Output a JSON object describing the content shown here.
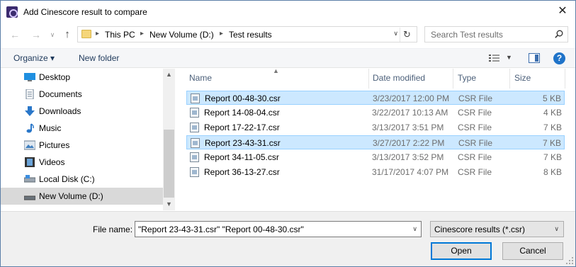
{
  "window": {
    "title": "Add Cinescore result to compare",
    "close_glyph": "✕"
  },
  "address": {
    "crumbs": [
      "This PC",
      "New Volume (D:)",
      "Test results"
    ],
    "search_placeholder": "Search Test results"
  },
  "toolbar": {
    "organize_label": "Organize ▾",
    "new_folder_label": "New folder",
    "help_glyph": "?"
  },
  "nav": {
    "items": [
      {
        "label": "Desktop",
        "icon": "desktop-icon"
      },
      {
        "label": "Documents",
        "icon": "documents-icon"
      },
      {
        "label": "Downloads",
        "icon": "downloads-icon"
      },
      {
        "label": "Music",
        "icon": "music-icon"
      },
      {
        "label": "Pictures",
        "icon": "pictures-icon"
      },
      {
        "label": "Videos",
        "icon": "videos-icon"
      },
      {
        "label": "Local Disk (C:)",
        "icon": "drive-icon"
      },
      {
        "label": "New Volume (D:)",
        "icon": "drive-icon",
        "selected": true
      }
    ]
  },
  "files": {
    "columns": {
      "name": "Name",
      "date": "Date modified",
      "type": "Type",
      "size": "Size"
    },
    "rows": [
      {
        "name": "Report 00-48-30.csr",
        "date": "3/23/2017 12:00 PM",
        "type": "CSR File",
        "size": "5 KB",
        "selected": true
      },
      {
        "name": "Report 14-08-04.csr",
        "date": "3/22/2017 10:13 AM",
        "type": "CSR File",
        "size": "4 KB",
        "selected": false
      },
      {
        "name": "Report 17-22-17.csr",
        "date": "3/13/2017 3:51 PM",
        "type": "CSR File",
        "size": "7 KB",
        "selected": false
      },
      {
        "name": "Report 23-43-31.csr",
        "date": "3/27/2017 2:22 PM",
        "type": "CSR File",
        "size": "7 KB",
        "selected": true
      },
      {
        "name": "Report 34-11-05.csr",
        "date": "3/13/2017 3:52 PM",
        "type": "CSR File",
        "size": "7 KB",
        "selected": false
      },
      {
        "name": "Report 36-13-27.csr",
        "date": "31/17/2017 4:07 PM",
        "type": "CSR File",
        "size": "8 KB",
        "selected": false
      }
    ]
  },
  "footer": {
    "filename_label": "File name:",
    "filename_value": "\"Report 23-43-31.csr\" \"Report 00-48-30.csr\"",
    "filetype_value": "Cinescore results (*.csr)",
    "open_label": "Open",
    "cancel_label": "Cancel"
  },
  "colors": {
    "selection_bg": "#cce8ff",
    "selection_border": "#99d1ff",
    "nav_selected": "#d9d9d9",
    "link_text": "#1e395b",
    "accent": "#0078d7"
  }
}
